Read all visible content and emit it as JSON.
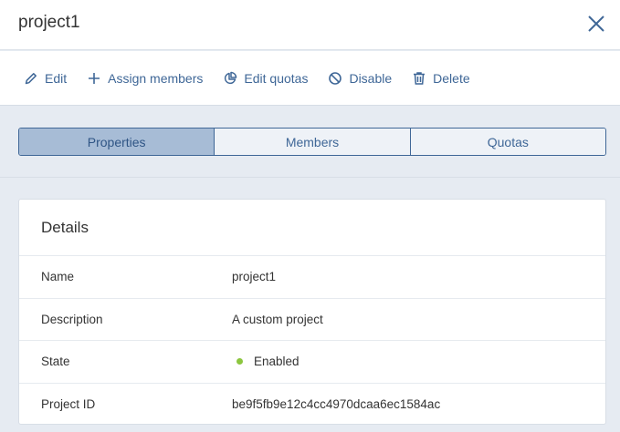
{
  "header": {
    "title": "project1"
  },
  "toolbar": {
    "edit": "Edit",
    "assign_members": "Assign members",
    "edit_quotas": "Edit quotas",
    "disable": "Disable",
    "delete": "Delete"
  },
  "tabs": [
    "Properties",
    "Members",
    "Quotas"
  ],
  "details": {
    "title": "Details",
    "rows": [
      {
        "label": "Name",
        "value": "project1"
      },
      {
        "label": "Description",
        "value": "A custom project"
      },
      {
        "label": "State",
        "value": "Enabled"
      },
      {
        "label": "Project ID",
        "value": "be9f5fb9e12c4cc4970dcaa6ec1584ac"
      }
    ]
  },
  "colors": {
    "accent": "#3f6797",
    "active_tab": "#a7bcd6",
    "status_enabled": "#8cc63f"
  },
  "icons": [
    "pencil-icon",
    "plus-icon",
    "pie-chart-icon",
    "ban-icon",
    "trash-icon",
    "close-icon"
  ]
}
